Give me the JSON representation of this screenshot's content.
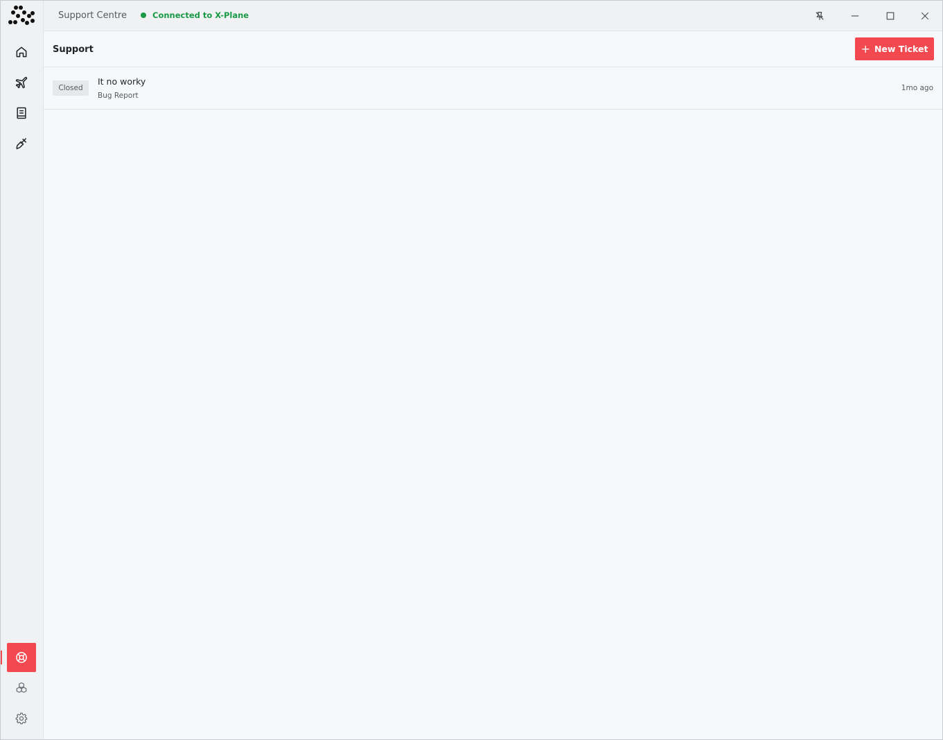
{
  "app": {
    "title": "Support Centre",
    "status": "Connected to X-Plane",
    "status_color": "#1a9a46",
    "accent_color": "#f2484f"
  },
  "sidebar": {
    "items": [
      {
        "name": "home",
        "icon": "home-icon"
      },
      {
        "name": "flights",
        "icon": "airplane-icon"
      },
      {
        "name": "logbook",
        "icon": "book-icon"
      },
      {
        "name": "liveries",
        "icon": "paint-brush-icon"
      },
      {
        "name": "support",
        "icon": "lifebuoy-icon",
        "active": true
      },
      {
        "name": "addons",
        "icon": "cubes-icon"
      },
      {
        "name": "settings",
        "icon": "gear-icon"
      }
    ]
  },
  "window_controls": [
    "unpin-icon",
    "minimize-icon",
    "maximize-icon",
    "close-icon"
  ],
  "header": {
    "title": "Support",
    "new_ticket_label": "New Ticket"
  },
  "tickets": [
    {
      "status": "Closed",
      "title": "It no worky",
      "category": "Bug Report",
      "time": "1mo ago"
    }
  ]
}
